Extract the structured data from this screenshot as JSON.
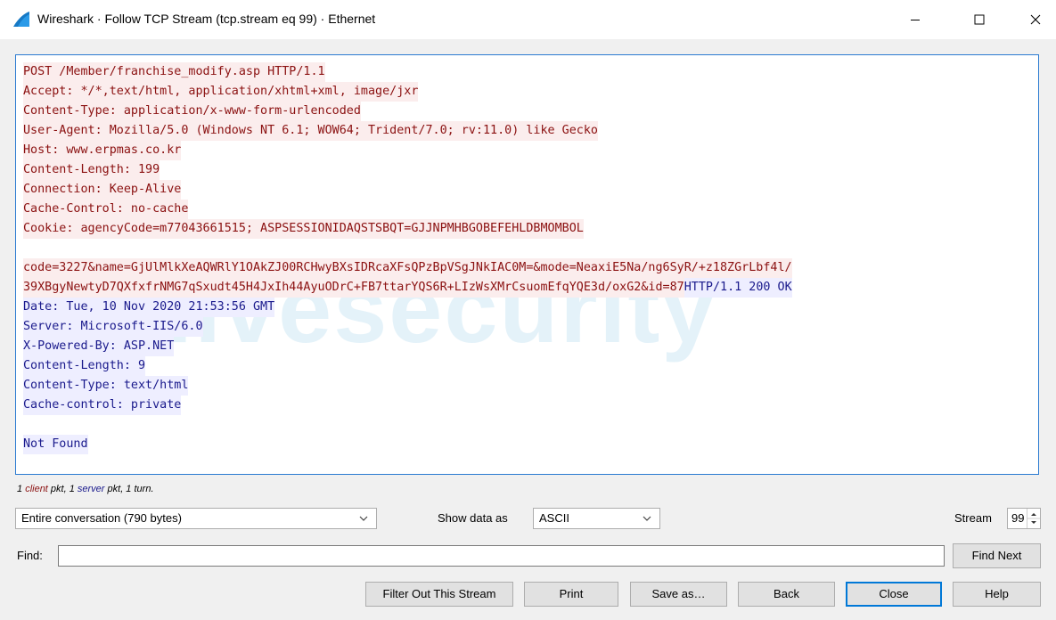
{
  "window": {
    "title": "Wireshark · Follow TCP Stream (tcp.stream eq 99) · Ethernet",
    "controls": [
      "minimize",
      "maximize",
      "close"
    ]
  },
  "stream": {
    "watermark": "welivesecurity",
    "lines": [
      [
        {
          "text": "POST /Member/franchise_modify.asp HTTP/1.1",
          "side": "client"
        }
      ],
      [
        {
          "text": "Accept: */*,text/html, application/xhtml+xml, image/jxr",
          "side": "client"
        }
      ],
      [
        {
          "text": "Content-Type: application/x-www-form-urlencoded",
          "side": "client"
        }
      ],
      [
        {
          "text": "User-Agent: Mozilla/5.0 (Windows NT 6.1; WOW64; Trident/7.0; rv:11.0) like Gecko",
          "side": "client"
        }
      ],
      [
        {
          "text": "Host: www.erpmas.co.kr",
          "side": "client"
        }
      ],
      [
        {
          "text": "Content-Length: 199",
          "side": "client"
        }
      ],
      [
        {
          "text": "Connection: Keep-Alive",
          "side": "client"
        }
      ],
      [
        {
          "text": "Cache-Control: no-cache",
          "side": "client"
        }
      ],
      [
        {
          "text": "Cookie: agencyCode=m77043661515; ASPSESSIONIDAQSTSBQT=GJJNPMHBGOBEFEHLDBMOMBOL",
          "side": "client"
        }
      ],
      [],
      [
        {
          "text": "code=3227&name=GjUlMlkXeAQWRlY1OAkZJ00RCHwyBXsIDRcaXFsQPzBpVSgJNkIAC0M=&mode=NeaxiE5Na/ng6SyR/+z18ZGrLbf4l/",
          "side": "client"
        }
      ],
      [
        {
          "text": "39XBgyNewtyD7QXfxfrNMG7qSxudt45H4JxIh44AyuODrC+FB7ttarYQS6R+LIzWsXMrCsuomEfqYQE3d/oxG2&id=87",
          "side": "client"
        },
        {
          "text": "HTTP/1.1 200 OK",
          "side": "server"
        }
      ],
      [
        {
          "text": "Date: Tue, 10 Nov 2020 21:53:56 GMT",
          "side": "server"
        }
      ],
      [
        {
          "text": "Server: Microsoft-IIS/6.0",
          "side": "server"
        }
      ],
      [
        {
          "text": "X-Powered-By: ASP.NET",
          "side": "server"
        }
      ],
      [
        {
          "text": "Content-Length: 9",
          "side": "server"
        }
      ],
      [
        {
          "text": "Content-Type: text/html",
          "side": "server"
        }
      ],
      [
        {
          "text": "Cache-control: private",
          "side": "server"
        }
      ],
      [],
      [
        {
          "text": "Not Found",
          "side": "server"
        }
      ]
    ]
  },
  "summary": {
    "prefix": "1 ",
    "client": "client",
    "middle": " pkt, 1 ",
    "server": "server",
    "suffix": " pkt, 1 turn."
  },
  "conversation_select": "Entire conversation (790 bytes)",
  "show_data_label": "Show data as",
  "show_data_select": "ASCII",
  "stream_label": "Stream",
  "stream_value": "99",
  "find_label": "Find:",
  "find_value": "",
  "buttons": {
    "find_next": "Find Next",
    "filter_out": "Filter Out This Stream",
    "print": "Print",
    "save_as": "Save as…",
    "back": "Back",
    "close": "Close",
    "help": "Help"
  },
  "colors": {
    "client_text": "#8b1111",
    "client_bg": "#fbeded",
    "server_text": "#1a1a8c",
    "server_bg": "#eeeeff",
    "accent": "#0078d7"
  }
}
